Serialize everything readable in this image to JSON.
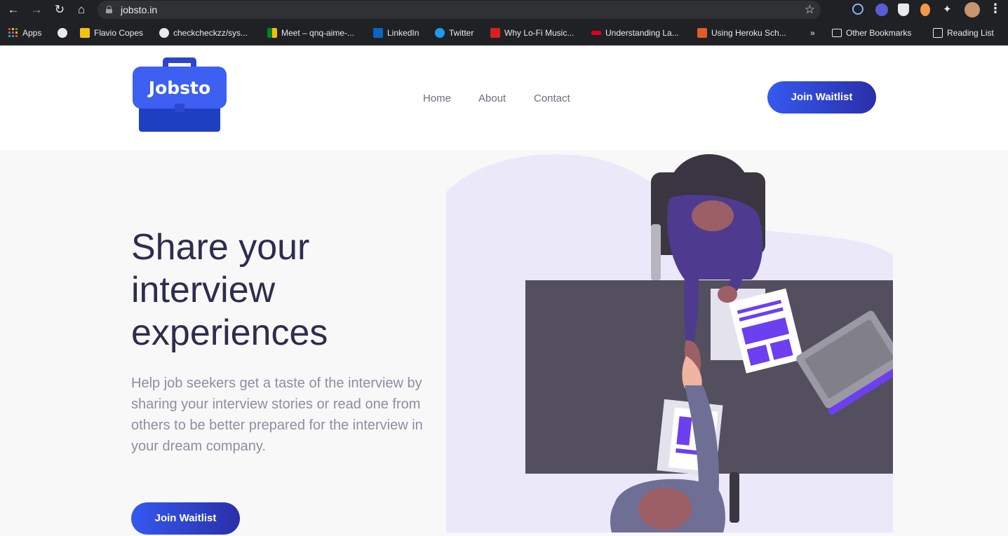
{
  "browser": {
    "url": "jobsto.in",
    "bookmarks": [
      "Apps",
      "Flavio Copes",
      "checkcheckzz/sys...",
      "Meet – qnq-aime-...",
      "LinkedIn",
      "Twitter",
      "Why Lo-Fi Music...",
      "Understanding La...",
      "Using Heroku Sch...",
      "»",
      "Other Bookmarks",
      "Reading List"
    ]
  },
  "site": {
    "logo_text": "Jobsto",
    "nav": [
      "Home",
      "About",
      "Contact"
    ],
    "header_cta": "Join Waitlist"
  },
  "hero": {
    "title_lines": [
      "Share your",
      "interview",
      "experiences"
    ],
    "description": "Help job seekers get a taste of the interview by sharing your interview stories or read one from others to be better prepared for the interview in your dream company.",
    "cta": "Join Waitlist"
  },
  "colors": {
    "accent": "#3559f0",
    "accent_dark": "#2a2fa8",
    "heading": "#2e2d4d",
    "body_text": "#8c8fa0",
    "illustration_purple": "#6c3ff0",
    "desk": "#544f5e",
    "blob": "#ebe8fa"
  }
}
